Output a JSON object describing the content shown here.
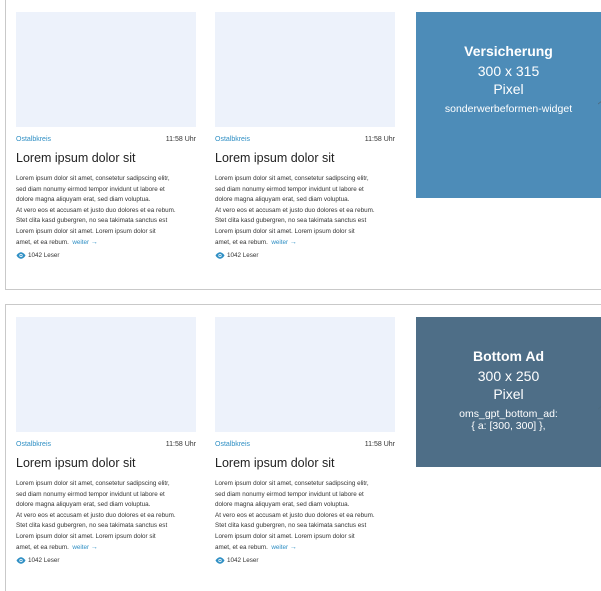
{
  "sections": [
    {
      "cards": [
        {
          "region": "Ostalbkreis",
          "time": "11:58 Uhr",
          "title": "Lorem ipsum dolor sit",
          "body_lines": [
            "Lorem ipsum dolor sit amet, consetetur sadipscing elitr,",
            "sed diam nonumy eirmod tempor invidunt ut labore et",
            "dolore magna aliquyam erat, sed diam voluptua.",
            "At vero eos et accusam et justo duo dolores et ea rebum.",
            "Stet clita kasd gubergren, no sea takimata sanctus est",
            "Lorem ipsum dolor sit amet. Lorem ipsum dolor sit"
          ],
          "last_line": "amet,  et ea rebum.",
          "more_label": "weiter",
          "readers": "1042 Leser"
        },
        {
          "region": "Ostalbkreis",
          "time": "11:58 Uhr",
          "title": "Lorem ipsum dolor sit",
          "body_lines": [
            "Lorem ipsum dolor sit amet, consetetur sadipscing elitr,",
            "sed diam nonumy eirmod tempor invidunt ut labore et",
            "dolore magna aliquyam erat, sed diam voluptua.",
            "At vero eos et accusam et justo duo dolores et ea rebum.",
            "Stet clita kasd gubergren, no sea takimata sanctus est",
            "Lorem ipsum dolor sit amet. Lorem ipsum dolor sit"
          ],
          "last_line": "amet,  et ea rebum.",
          "more_label": "weiter",
          "readers": "1042 Leser"
        }
      ],
      "ad": {
        "title": "Versicherung",
        "size": "300 x 315",
        "unit": "Pixel",
        "code": "sonderwerbeformen-widget",
        "color": "#4d8cb8"
      }
    },
    {
      "cards": [
        {
          "region": "Ostalbkreis",
          "time": "11:58 Uhr",
          "title": "Lorem ipsum dolor sit",
          "body_lines": [
            "Lorem ipsum dolor sit amet, consetetur sadipscing elitr,",
            "sed diam nonumy eirmod tempor invidunt ut labore et",
            "dolore magna aliquyam erat, sed diam voluptua.",
            "At vero eos et accusam et justo duo dolores et ea rebum.",
            "Stet clita kasd gubergren, no sea takimata sanctus est",
            "Lorem ipsum dolor sit amet. Lorem ipsum dolor sit"
          ],
          "last_line": "amet,  et ea rebum.",
          "more_label": "weiter",
          "readers": "1042 Leser"
        },
        {
          "region": "Ostalbkreis",
          "time": "11:58 Uhr",
          "title": "Lorem ipsum dolor sit",
          "body_lines": [
            "Lorem ipsum dolor sit amet, consetetur sadipscing elitr,",
            "sed diam nonumy eirmod tempor invidunt ut labore et",
            "dolore magna aliquyam erat, sed diam voluptua.",
            "At vero eos et accusam et justo duo dolores et ea rebum.",
            "Stet clita kasd gubergren, no sea takimata sanctus est",
            "Lorem ipsum dolor sit amet. Lorem ipsum dolor sit"
          ],
          "last_line": "amet,  et ea rebum.",
          "more_label": "weiter",
          "readers": "1042 Leser"
        }
      ],
      "ad": {
        "title": "Bottom Ad",
        "size": "300 x 250",
        "unit": "Pixel",
        "code_lines": [
          "oms_gpt_bottom_ad:",
          "{ a: [300, 300] },"
        ],
        "color": "#4e6e87"
      }
    }
  ],
  "icons": {
    "readers": "eye-icon",
    "more": "arrow-right-icon"
  }
}
